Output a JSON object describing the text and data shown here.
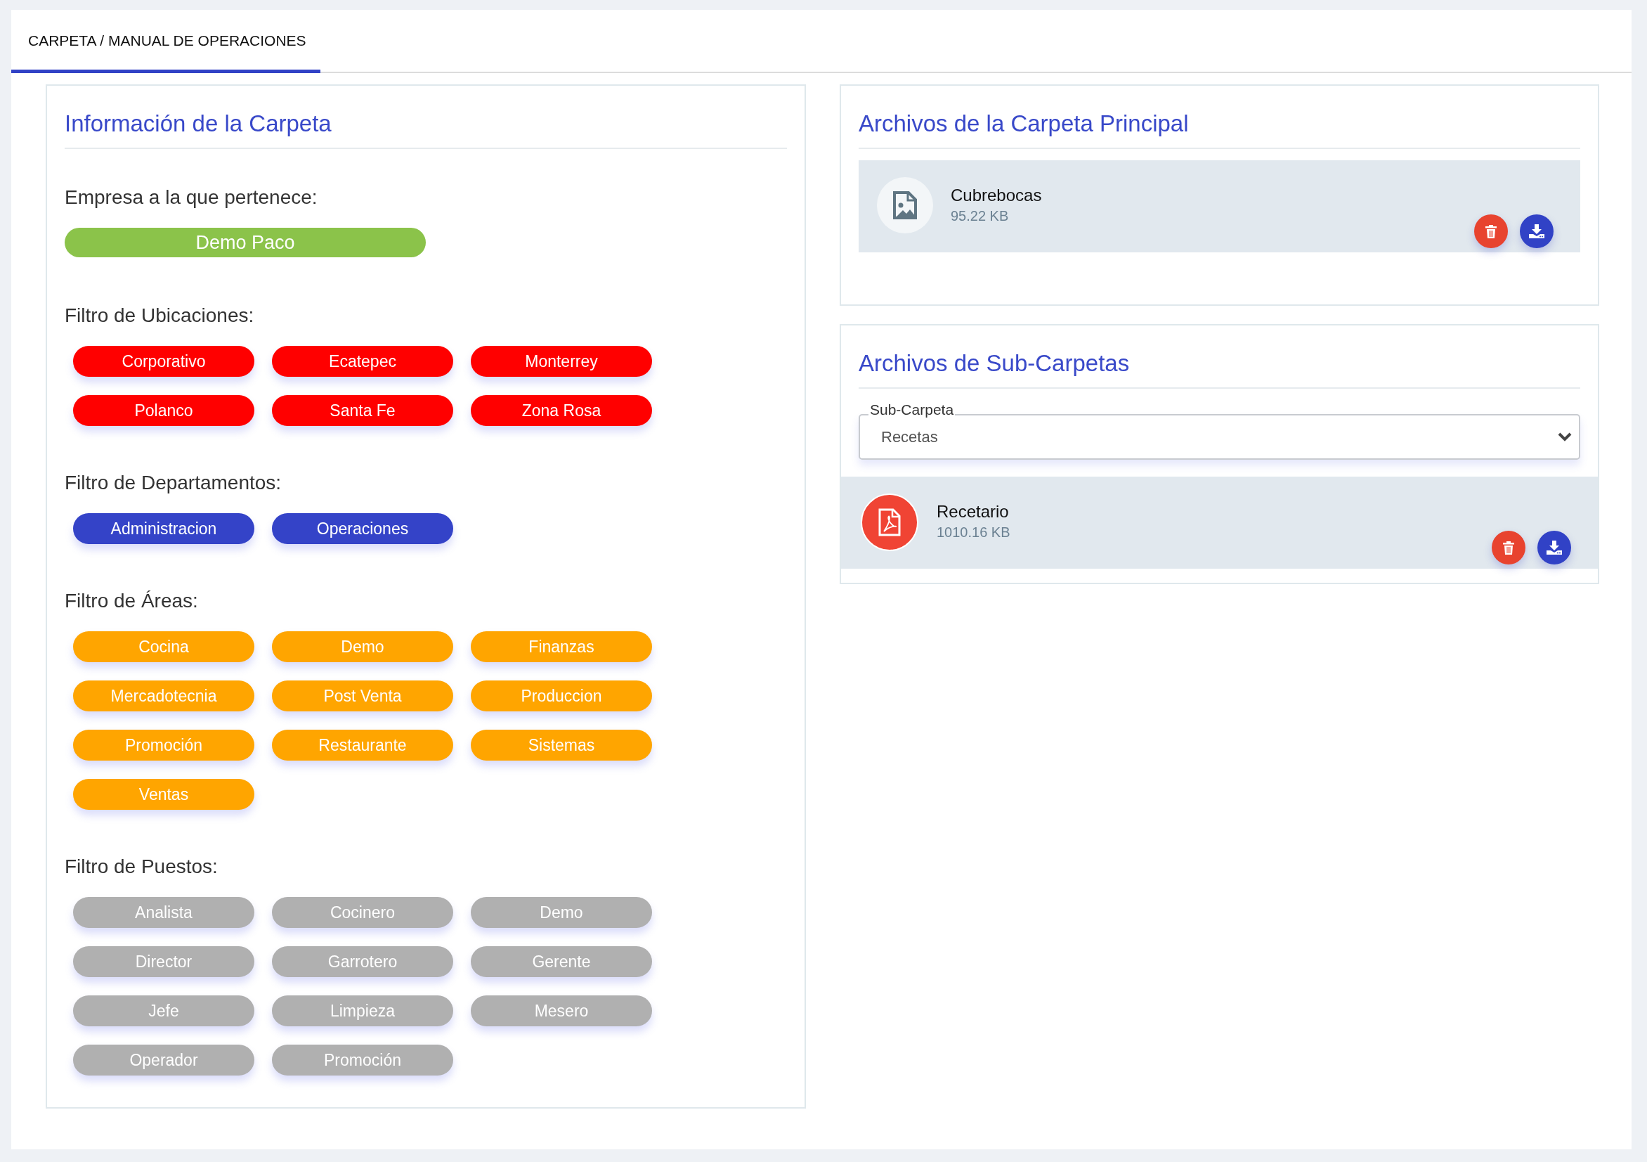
{
  "tab": {
    "label": "CARPETA / MANUAL DE OPERACIONES",
    "selected": true
  },
  "info": {
    "title": "Información de la Carpeta",
    "company_label": "Empresa a la que pertenece:",
    "company": "Demo Paco",
    "filters": [
      {
        "label": "Filtro de Ubicaciones:",
        "color": "#ff0000",
        "items": [
          "Corporativo",
          "Ecatepec",
          "Monterrey",
          "Polanco",
          "Santa Fe",
          "Zona Rosa"
        ]
      },
      {
        "label": "Filtro de Departamentos:",
        "color": "#3443c8",
        "items": [
          "Administracion",
          "Operaciones"
        ]
      },
      {
        "label": "Filtro de Áreas:",
        "color": "#ffa500",
        "items": [
          "Cocina",
          "Demo",
          "Finanzas",
          "Mercadotecnia",
          "Post Venta",
          "Produccion",
          "Promoción",
          "Restaurante",
          "Sistemas",
          "Ventas"
        ]
      },
      {
        "label": "Filtro de Puestos:",
        "color": "#b0b0b0",
        "items": [
          "Analista",
          "Cocinero",
          "Demo",
          "Director",
          "Garrotero",
          "Gerente",
          "Jefe",
          "Limpieza",
          "Mesero",
          "Operador",
          "Promoción"
        ]
      }
    ]
  },
  "main_files": {
    "title": "Archivos de la Carpeta Principal",
    "files": [
      {
        "kind": "image",
        "name": "Cubrebocas",
        "size": "95.22 KB"
      }
    ]
  },
  "sub_files": {
    "title": "Archivos de Sub-Carpetas",
    "select_label": "Sub-Carpeta",
    "select_value": "Recetas",
    "files": [
      {
        "kind": "pdf",
        "name": "Recetario",
        "size": "1010.16 KB"
      }
    ]
  }
}
